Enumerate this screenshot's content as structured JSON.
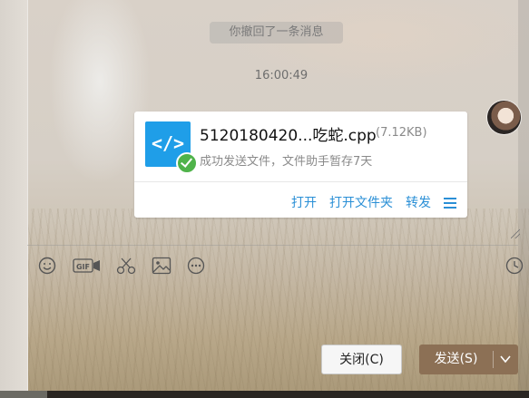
{
  "chat": {
    "recall_notice": "你撤回了一条消息",
    "timestamp": "16:00:49"
  },
  "file_message": {
    "file_name": "5120180420...吃蛇.cpp",
    "file_size": "(7.12KB)",
    "status": "成功发送文件，文件助手暂存7天",
    "icon": "code-file-icon",
    "actions": {
      "open": "打开",
      "open_folder": "打开文件夹",
      "forward": "转发",
      "more_icon": "menu-icon"
    },
    "colors": {
      "accent": "#2a8fd6",
      "file_icon": "#1f9ee8",
      "success": "#4fb34a"
    }
  },
  "toolbar": {
    "icons": [
      "emoji-icon",
      "gif-icon",
      "scissors-icon",
      "image-icon",
      "more-icon",
      "history-clock-icon"
    ],
    "gif_label": "GIF"
  },
  "buttons": {
    "close_label": "关闭(C)",
    "send_label": "发送(S)",
    "send_color": "#8c7055"
  }
}
